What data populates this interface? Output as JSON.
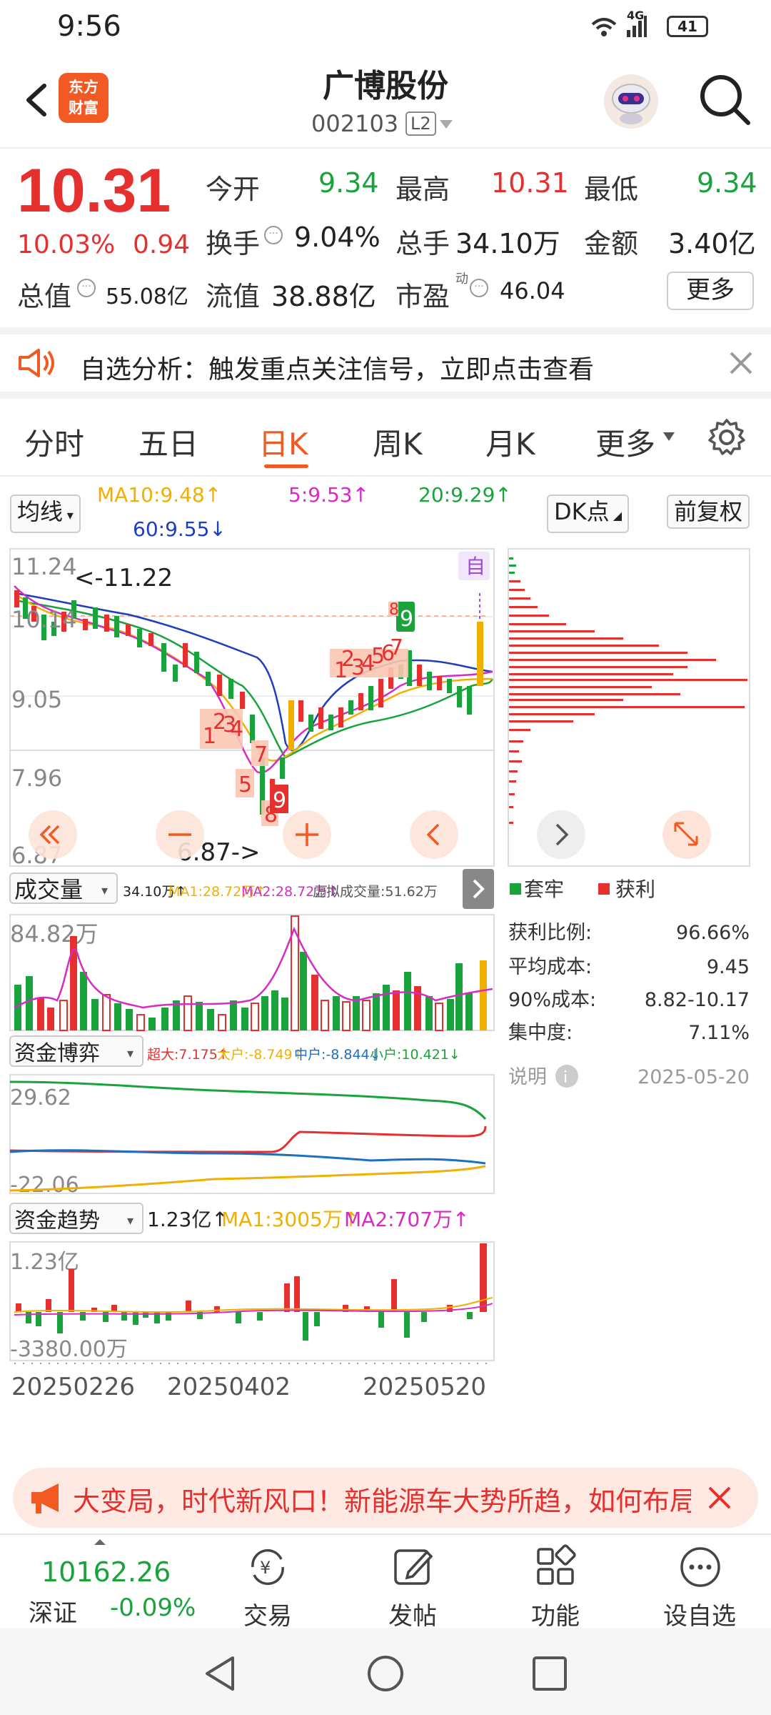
{
  "status": {
    "time": "9:56",
    "network": "4G",
    "battery": "41"
  },
  "header": {
    "logo_text": "东方财富",
    "stock_name": "广博股份",
    "stock_code": "002103",
    "level_badge": "L2"
  },
  "quote": {
    "price": "10.31",
    "change_pct": "10.03%",
    "change": "0.94",
    "open_label": "今开",
    "open": "9.34",
    "high_label": "最高",
    "high": "10.31",
    "low_label": "最低",
    "low": "9.34",
    "turnover_label": "换手",
    "turnover": "9.04%",
    "volume_label": "总手",
    "volume": "34.10万",
    "amount_label": "金额",
    "amount": "3.40亿",
    "mktcap_label": "总值",
    "mktcap": "55.08亿",
    "float_label": "流值",
    "float_cap": "38.88亿",
    "pe_label": "市盈",
    "pe_sup": "动",
    "pe": "46.04",
    "more_label": "更多"
  },
  "alert": {
    "text": "自选分析：触发重点关注信号，立即点击查看"
  },
  "tabs": {
    "t1": "分时",
    "t2": "五日",
    "t3": "日K",
    "t4": "周K",
    "t5": "月K",
    "t6": "更多"
  },
  "ma": {
    "selector": "均线",
    "ma10": "MA10:9.48↑",
    "ma5": "5:9.53↑",
    "ma20": "20:9.29↑",
    "ma60": "60:9.55↓",
    "dk": "DK点",
    "fq": "前复权"
  },
  "kline": {
    "y_top": "11.24",
    "y2": "10.14",
    "y3": "9.05",
    "y4": "7.96",
    "y_bottom": "6.87",
    "high_mark": "<-11.22",
    "low_mark": "6.87->",
    "self_tag": "自",
    "signal_9": "9",
    "signals_a": [
      "1",
      "2",
      "3",
      "4"
    ],
    "signals_b": [
      "5",
      "7",
      "8",
      "9"
    ],
    "signals_c": [
      "1",
      "2",
      "3",
      "4",
      "5",
      "6",
      "7"
    ],
    "signals_d": [
      "8"
    ]
  },
  "volume_panel": {
    "selector": "成交量",
    "vol": "34.10万↑",
    "ma1": "MA1:28.72万↑",
    "ma2": "MA2:28.72万↑",
    "virtual": "虚拟成交量:51.62万",
    "y_top": "84.82万"
  },
  "fund_game": {
    "selector": "资金博弈",
    "super": "超大:7.175↑",
    "big": "大户:-8.749↑",
    "mid": "中户:-8.844↓",
    "small": "小户:10.421↓",
    "y_top": "29.62",
    "y_bottom": "-22.06"
  },
  "fund_trend": {
    "selector": "资金趋势",
    "val": "1.23亿↑",
    "ma1": "MA1:3005万↑",
    "ma2": "MA2:707万↑",
    "y_top": "1.23亿",
    "y_bottom": "-3380.00万"
  },
  "x_axis": {
    "d1": "20250226",
    "d2": "20250402",
    "d3": "20250520"
  },
  "chip": {
    "legend_trapped": "套牢",
    "legend_profit": "获利",
    "profit_ratio_label": "获利比例:",
    "profit_ratio": "96.66%",
    "avg_cost_label": "平均成本:",
    "avg_cost": "9.45",
    "cost90_label": "90%成本:",
    "cost90": "8.82-10.17",
    "concentration_label": "集中度:",
    "concentration": "7.11%",
    "note_label": "说明",
    "date": "2025-05-20"
  },
  "banner": {
    "text": "大变局，时代新风口！新能源车大势所趋，如何布局"
  },
  "bottom_nav": {
    "index_value": "10162.26",
    "index_name": "深证",
    "index_change": "-0.09%",
    "trade": "交易",
    "post": "发帖",
    "func": "功能",
    "watch": "设自选"
  },
  "colors": {
    "up": "#e5302f",
    "down": "#1aa33c",
    "brand": "#f15a22",
    "ma5": "#d62bc5",
    "ma10": "#f0b000",
    "ma20": "#1aa33c",
    "ma60": "#1d3fbf"
  }
}
